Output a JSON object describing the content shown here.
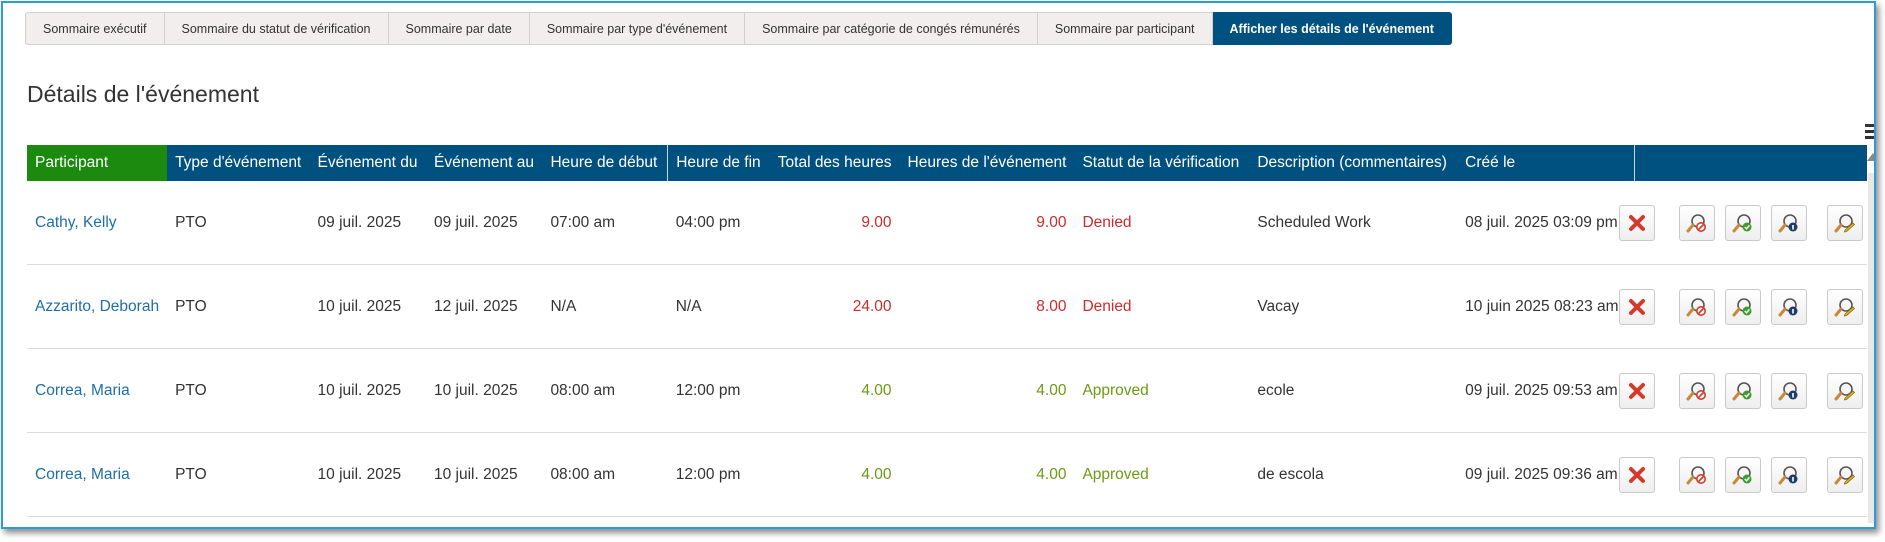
{
  "tabs": [
    {
      "label": "Sommaire exécutif"
    },
    {
      "label": "Sommaire du statut de vérification"
    },
    {
      "label": "Sommaire par date"
    },
    {
      "label": "Sommaire par type d'événement"
    },
    {
      "label": "Sommaire par catégorie de congés rémunérés"
    },
    {
      "label": "Sommaire par participant"
    },
    {
      "label": "Afficher les détails de l'événement"
    }
  ],
  "page_title": "Détails de l'événement",
  "columns": {
    "participant": "Participant",
    "event_type": "Type d'événement",
    "event_from": "Événement du",
    "event_to": "Événement au",
    "start_time": "Heure de début",
    "end_time": "Heure de fin",
    "total_hours": "Total des heures",
    "event_hours": "Heures de l'événement",
    "status": "Statut de la vérification",
    "description": "Description (commentaires)",
    "created": "Créé le"
  },
  "rows": [
    {
      "participant": "Cathy, Kelly",
      "type": "PTO",
      "from": "09 juil. 2025",
      "to": "09 juil. 2025",
      "start": "07:00 am",
      "end": "04:00 pm",
      "total": "9.00",
      "hours": "9.00",
      "status": "Denied",
      "description": "Scheduled Work",
      "created": "08 juil. 2025 03:09 pm"
    },
    {
      "participant": "Azzarito, Deborah",
      "type": "PTO",
      "from": "10 juil. 2025",
      "to": "12 juil. 2025",
      "start": "N/A",
      "end": "N/A",
      "total": "24.00",
      "hours": "8.00",
      "status": "Denied",
      "description": "Vacay",
      "created": "10 juin 2025 08:23 am"
    },
    {
      "participant": "Correa, Maria",
      "type": "PTO",
      "from": "10 juil. 2025",
      "to": "10 juil. 2025",
      "start": "08:00 am",
      "end": "12:00 pm",
      "total": "4.00",
      "hours": "4.00",
      "status": "Approved",
      "description": "ecole",
      "created": "09 juil. 2025 09:53 am"
    },
    {
      "participant": "Correa, Maria",
      "type": "PTO",
      "from": "10 juil. 2025",
      "to": "10 juil. 2025",
      "start": "08:00 am",
      "end": "12:00 pm",
      "total": "4.00",
      "hours": "4.00",
      "status": "Approved",
      "description": "de escola",
      "created": "09 juil. 2025 09:36 am"
    }
  ],
  "colors": {
    "accent": "#005180",
    "participant_header": "#1b8a0e",
    "denied": "#cc2b2b",
    "approved": "#6c9a12",
    "link": "#1f6ea8"
  },
  "icons": [
    "delete-x-icon",
    "deny-magnifier-icon",
    "approve-magnifier-icon",
    "info-magnifier-icon",
    "edit-magnifier-icon",
    "menu-icon"
  ]
}
